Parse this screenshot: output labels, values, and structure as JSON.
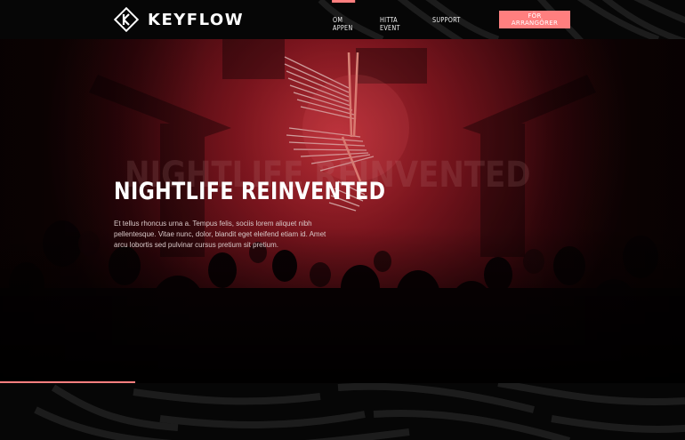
{
  "brand": {
    "name": "KEYFLOW",
    "logo_icon": "diamond-k-logo-icon"
  },
  "nav": {
    "items": [
      {
        "label": "OM APPEN",
        "active": true
      },
      {
        "label": "HITTA EVENT",
        "active": false
      },
      {
        "label": "SUPPORT",
        "active": false
      }
    ],
    "cta_label": "FÖR ARRANGÖRER"
  },
  "hero": {
    "ghost_title": "NIGHTLIFE REINVENTED",
    "title": "NIGHTLIFE REINVENTED",
    "body": "Et tellus rhoncus urna a. Tempus felis, sociis lorem aliquet nibh pellentesque. Vitae nunc, dolor, blandit eget eleifend etiam id. Amet arcu lobortis sed pulvinar cursus pretium sit pretium.",
    "image": "nightclub-crowd-red-light-installation"
  },
  "colors": {
    "accent": "#ff7f7f",
    "background": "#060606",
    "hero_tint": "#c0202c"
  }
}
